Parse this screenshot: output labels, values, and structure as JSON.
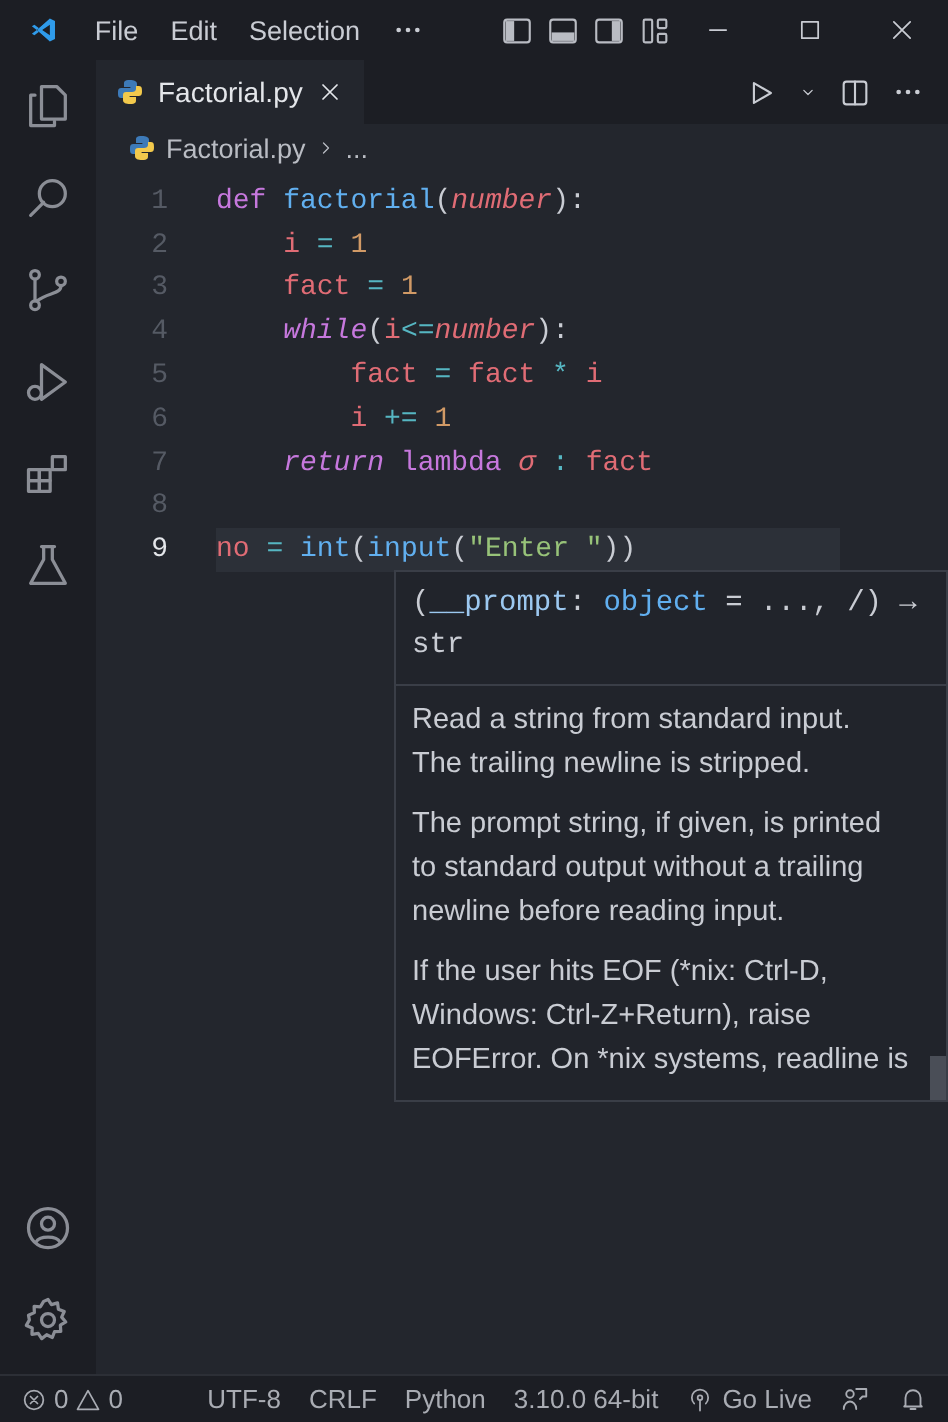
{
  "menu": [
    "File",
    "Edit",
    "Selection"
  ],
  "tab": {
    "label": "Factorial.py",
    "selected": true
  },
  "breadcrumb": {
    "file": "Factorial.py",
    "rest": "..."
  },
  "code_lines": [
    {
      "number": "1",
      "current": false,
      "tokens": [
        {
          "text": "def ",
          "kind": "keyword"
        },
        {
          "text": "factorial",
          "kind": "func"
        },
        {
          "text": "(",
          "kind": "punc"
        },
        {
          "text": "number",
          "kind": "param"
        },
        {
          "text": "):",
          "kind": "punc"
        }
      ]
    },
    {
      "number": "2",
      "current": false,
      "tokens": [
        {
          "text": "    i",
          "kind": "var"
        },
        {
          "text": " = ",
          "kind": "op"
        },
        {
          "text": "1",
          "kind": "num"
        }
      ]
    },
    {
      "number": "3",
      "current": false,
      "tokens": [
        {
          "text": "    fact",
          "kind": "var"
        },
        {
          "text": " = ",
          "kind": "op"
        },
        {
          "text": "1",
          "kind": "num"
        }
      ]
    },
    {
      "number": "4",
      "current": false,
      "tokens": [
        {
          "text": "    while",
          "kind": "keyword-italic"
        },
        {
          "text": "(",
          "kind": "punc"
        },
        {
          "text": "i",
          "kind": "var"
        },
        {
          "text": "<=",
          "kind": "op"
        },
        {
          "text": "number",
          "kind": "param"
        },
        {
          "text": "):",
          "kind": "punc"
        }
      ]
    },
    {
      "number": "5",
      "current": false,
      "tokens": [
        {
          "text": "        fact",
          "kind": "var"
        },
        {
          "text": " = ",
          "kind": "op"
        },
        {
          "text": "fact",
          "kind": "var"
        },
        {
          "text": " * ",
          "kind": "op"
        },
        {
          "text": "i",
          "kind": "var"
        }
      ]
    },
    {
      "number": "6",
      "current": false,
      "tokens": [
        {
          "text": "        i",
          "kind": "var"
        },
        {
          "text": " += ",
          "kind": "op"
        },
        {
          "text": "1",
          "kind": "num"
        }
      ]
    },
    {
      "number": "7",
      "current": false,
      "tokens": [
        {
          "text": "    return",
          "kind": "keyword-italic"
        },
        {
          "text": " lambda ",
          "kind": "keyword"
        },
        {
          "text": "σ",
          "kind": "param"
        },
        {
          "text": " : ",
          "kind": "op"
        },
        {
          "text": "fact",
          "kind": "var"
        }
      ]
    },
    {
      "number": "8",
      "current": false
    },
    {
      "number": "9",
      "current": true,
      "tokens": [
        {
          "text": "no",
          "kind": "var"
        },
        {
          "text": " = ",
          "kind": "op"
        },
        {
          "text": "int",
          "kind": "func"
        },
        {
          "text": "(",
          "kind": "punc"
        },
        {
          "text": "input",
          "kind": "func"
        },
        {
          "text": "(",
          "kind": "punc"
        },
        {
          "text": "\"Enter \"",
          "kind": "string"
        },
        {
          "text": "))",
          "kind": "punc"
        }
      ]
    }
  ],
  "hover": {
    "signature": [
      {
        "text": "(",
        "kind": "punc"
      },
      {
        "text": "__prompt",
        "kind": "param"
      },
      {
        "text": ": ",
        "kind": "punc"
      },
      {
        "text": "object",
        "kind": "func"
      },
      {
        "text": " = ..., /) → str",
        "kind": "punc"
      }
    ],
    "paragraphs": [
      "Read a string from standard input.\nThe trailing newline is stripped.",
      "The prompt string, if given, is printed\nto standard output without a trailing\nnewline before reading input.",
      "If the user hits EOF (*nix: Ctrl-D,\nWindows: Ctrl-Z+Return), raise\nEOFError. On *nix systems, readline is"
    ]
  },
  "status_bar": {
    "errors": "0",
    "warnings": "0",
    "items": [
      "UTF-8",
      "CRLF",
      "Python",
      "3.10.0 64-bit"
    ],
    "go_live": "Go Live"
  }
}
